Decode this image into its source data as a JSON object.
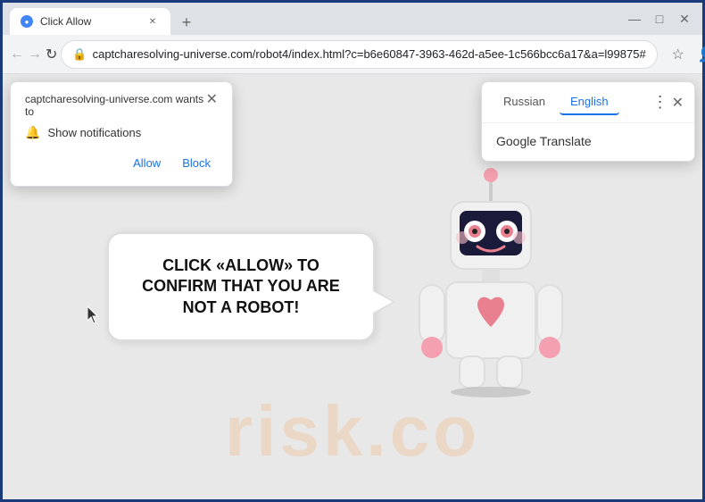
{
  "browser": {
    "tab": {
      "title": "Click Allow",
      "favicon": "🔵"
    },
    "url": "captcharesolving-universe.com/robot4/index.html?c=b6e60847-3963-462d-a5ee-1c566bcc6a17&a=l99875#",
    "window_controls": {
      "minimize": "—",
      "maximize": "□",
      "close": "✕"
    }
  },
  "notification_popup": {
    "site_text": "captcharesolving-universe.com wants to",
    "close_icon": "✕",
    "bell_icon": "🔔",
    "notification_text": "Show notifications",
    "allow_label": "Allow",
    "block_label": "Block"
  },
  "translate_popup": {
    "russian_tab": "Russian",
    "english_tab": "English",
    "service_label": "Google Translate",
    "close_icon": "✕",
    "more_icon": "⋮"
  },
  "page": {
    "bubble_text": "CLICK «ALLOW» TO CONFIRM THAT YOU ARE NOT A ROBOT!",
    "watermark": "risk.co"
  },
  "nav": {
    "back": "←",
    "forward": "→",
    "reload": "↻"
  }
}
